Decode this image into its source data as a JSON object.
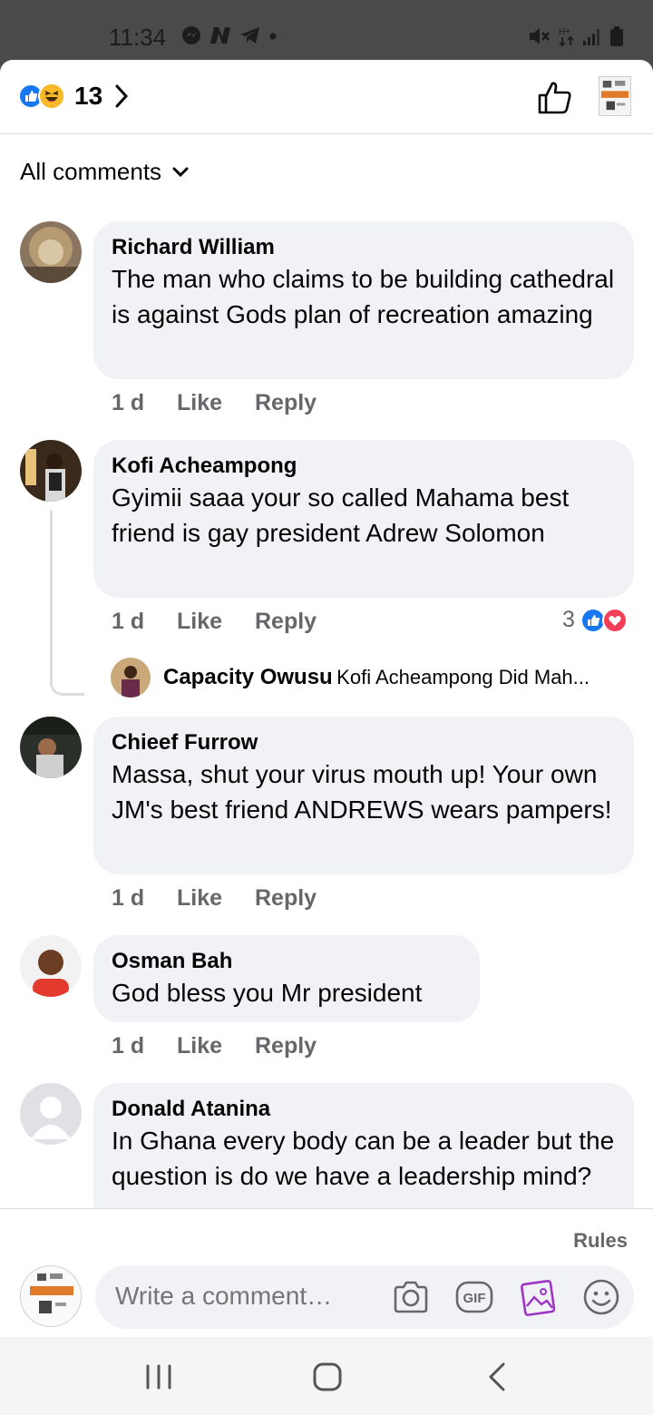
{
  "status": {
    "time": "11:34",
    "icons_left": [
      "messenger-icon",
      "n-icon",
      "telegram-icon",
      "dot-icon"
    ],
    "icons_right": [
      "mute-icon",
      "data-icon",
      "signal-icon",
      "battery-icon"
    ]
  },
  "header": {
    "reaction_icons": [
      "like-reaction",
      "haha-reaction"
    ],
    "reaction_count": "13",
    "like_icon": "thumbs-up-icon"
  },
  "filter": {
    "label": "All comments"
  },
  "comments": [
    {
      "author": "Richard William",
      "text": "The man who claims to be building cathedral is against Gods plan of recreation amazing",
      "time": "1 d",
      "like": "Like",
      "reply": "Reply"
    },
    {
      "author": "Kofi Acheampong",
      "text": "Gyimii  saaa your so called Mahama best friend  is gay president  Adrew Solomon",
      "time": "1 d",
      "like": "Like",
      "reply": "Reply",
      "reaction_count": "3",
      "reply_preview": {
        "author": "Capacity Owusu",
        "text": "Kofi Acheampong Did Mah..."
      }
    },
    {
      "author": "Chieef Furrow",
      "text": "Massa, shut your virus mouth up! Your own JM's best friend ANDREWS wears pampers!",
      "time": "1 d",
      "like": "Like",
      "reply": "Reply"
    },
    {
      "author": "Osman Bah",
      "text": "God bless you Mr president",
      "time": "1 d",
      "like": "Like",
      "reply": "Reply"
    },
    {
      "author": "Donald Atanina",
      "text": "In Ghana every body can be a leader but the question is do we have a leadership mind?"
    }
  ],
  "footer": {
    "rules": "Rules",
    "placeholder": "Write a comment…",
    "icons": [
      "camera-icon",
      "gif-icon",
      "sticker-icon",
      "emoji-icon"
    ]
  },
  "colors": {
    "bubble": "#f0f2f5",
    "secondary_text": "#65676b",
    "like_blue": "#1877f2",
    "love_red": "#f33e58",
    "haha_yellow": "#f7b928",
    "sticker_purple": "#a033c8"
  }
}
